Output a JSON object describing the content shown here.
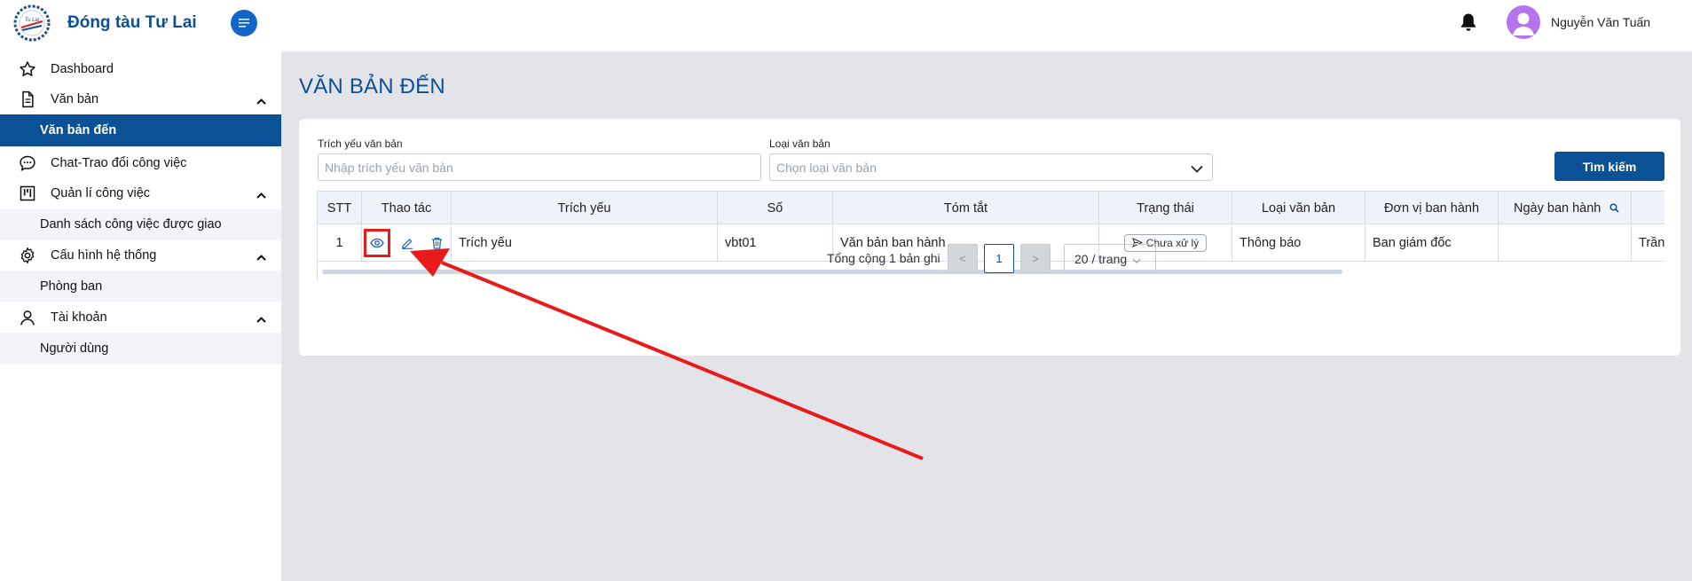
{
  "brand": {
    "name": "Đóng tàu Tư Lai",
    "logo_text": "Tu Lai shipyard"
  },
  "sidebar": {
    "items": [
      {
        "label": "Dashboard",
        "icon": "star-icon"
      },
      {
        "label": "Văn bản",
        "icon": "document-icon",
        "chevron": "chevron-up-icon"
      },
      {
        "label": "Văn bản đến",
        "active": true
      },
      {
        "label": "Chat-Trao đổi công việc",
        "icon": "chat-icon"
      },
      {
        "label": "Quản lí công việc",
        "icon": "kanban-icon",
        "chevron": "chevron-up-icon"
      },
      {
        "label": "Danh sách công việc được giao"
      },
      {
        "label": "Cấu hình hệ thống",
        "icon": "gear-icon",
        "chevron": "chevron-up-icon"
      },
      {
        "label": "Phòng ban"
      },
      {
        "label": "Tài khoản",
        "icon": "user-icon",
        "chevron": "chevron-up-icon"
      },
      {
        "label": "Người dùng"
      }
    ]
  },
  "header": {
    "username": "Nguyễn Văn Tuấn"
  },
  "page": {
    "title": "VĂN BẢN ĐẾN"
  },
  "filters": {
    "summary_label": "Trích yếu văn bản",
    "summary_placeholder": "Nhập trích yếu văn bản",
    "type_label": "Loại văn bản",
    "type_placeholder": "Chọn loại văn bản",
    "search_button": "Tìm kiếm"
  },
  "table": {
    "columns": [
      "STT",
      "Thao tác",
      "Trích yếu",
      "Số",
      "Tóm tắt",
      "Trạng thái",
      "Loại văn bản",
      "Đơn vị ban hành",
      "Ngày ban hành"
    ],
    "rows": [
      {
        "stt": "1",
        "trich_yeu": "Trích yếu",
        "so": "vbt01",
        "tom_tat": "Văn bản ban hành",
        "trang_thai": "Chưa xử lý",
        "loai": "Thông báo",
        "don_vi": "Ban giám đốc",
        "ngay": "",
        "extra": "Trần"
      }
    ]
  },
  "pagination": {
    "total_text": "Tổng cộng 1 bản ghi",
    "prev": "<",
    "current": "1",
    "next": ">",
    "page_size": "20 / trang"
  },
  "colors": {
    "primary": "#0b5196",
    "annotation": "#e81a1a",
    "avatar": "#b673ee"
  }
}
